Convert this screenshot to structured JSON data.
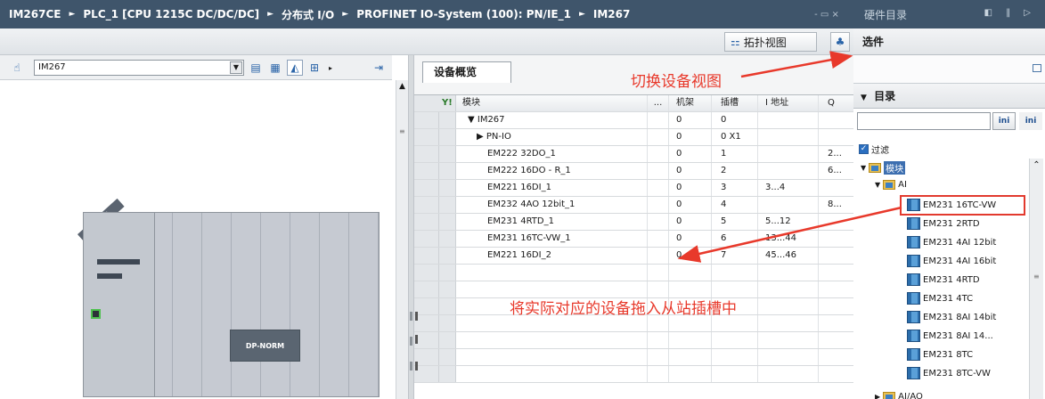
{
  "breadcrumb": {
    "items": [
      "IM267CE",
      "PLC_1 [CPU 1215C DC/DC/DC]",
      "分布式 I/O",
      "PROFINET IO-System (100): PN/IE_1",
      "IM267"
    ],
    "separator": "►",
    "window_controls": "- ▭ ×"
  },
  "view_tabs": {
    "topology": "拓扑视图",
    "network_icon": "network-view-icon"
  },
  "device_toolbar": {
    "selected_device": "IM267",
    "dropdown_icon": "▼"
  },
  "device_view": {
    "im_module_label": "IM267",
    "signal_module_label": "DP-NORM"
  },
  "overview": {
    "tab_label": "设备概览",
    "columns": {
      "filter_icon": "Y!",
      "module": "模块",
      "dots": "...",
      "rack": "机架",
      "slot": "插槽",
      "i_addr": "I 地址",
      "q_addr": "Q"
    },
    "rows": [
      {
        "name": "▼ IM267",
        "rack": "0",
        "slot": "0",
        "i": "",
        "q": ""
      },
      {
        "name": "▶ PN-IO",
        "rack": "0",
        "slot": "0 X1",
        "i": "",
        "q": ""
      },
      {
        "name": "EM222 32DO_1",
        "rack": "0",
        "slot": "1",
        "i": "",
        "q": "2..."
      },
      {
        "name": "EM222 16DO - R_1",
        "rack": "0",
        "slot": "2",
        "i": "",
        "q": "6..."
      },
      {
        "name": "EM221 16DI_1",
        "rack": "0",
        "slot": "3",
        "i": "3...4",
        "q": ""
      },
      {
        "name": "EM232 4AO 12bit_1",
        "rack": "0",
        "slot": "4",
        "i": "",
        "q": "8..."
      },
      {
        "name": "EM231 4RTD_1",
        "rack": "0",
        "slot": "5",
        "i": "5...12",
        "q": ""
      },
      {
        "name": "EM231 16TC-VW_1",
        "rack": "0",
        "slot": "6",
        "i": "13...44",
        "q": ""
      },
      {
        "name": "EM221 16DI_2",
        "rack": "0",
        "slot": "7",
        "i": "45...46",
        "q": ""
      },
      {
        "name": "",
        "rack": "",
        "slot": "",
        "i": "",
        "q": ""
      },
      {
        "name": "",
        "rack": "",
        "slot": "",
        "i": "",
        "q": ""
      },
      {
        "name": "",
        "rack": "",
        "slot": "",
        "i": "",
        "q": ""
      },
      {
        "name": "",
        "rack": "",
        "slot": "",
        "i": "",
        "q": ""
      },
      {
        "name": "",
        "rack": "",
        "slot": "",
        "i": "",
        "q": ""
      },
      {
        "name": "",
        "rack": "",
        "slot": "",
        "i": "",
        "q": ""
      },
      {
        "name": "",
        "rack": "",
        "slot": "",
        "i": "",
        "q": ""
      }
    ]
  },
  "catalog": {
    "title": "硬件目录",
    "title_controls": "◧ ‖ ▷",
    "options_label": "选件",
    "directory_label": "目录",
    "directory_toggle": "▼",
    "search_btn1": "ini",
    "search_btn2": "ini",
    "filter_label": "过滤",
    "tree": {
      "modules": "模块",
      "ai": "AI",
      "items": [
        "EM231 16TC-VW",
        "EM231 2RTD",
        "EM231 4AI 12bit",
        "EM231 4AI 16bit",
        "EM231 4RTD",
        "EM231 4TC",
        "EM231 8AI 14bit",
        "EM231 8AI 14...",
        "EM231 8TC",
        "EM231 8TC-VW"
      ],
      "aio": "AI/AO"
    }
  },
  "annotations": {
    "switch_view": "切换设备视图",
    "drag_hint": "将实际对应的设备拖入从站插槽中",
    "color": "#e8392b"
  }
}
